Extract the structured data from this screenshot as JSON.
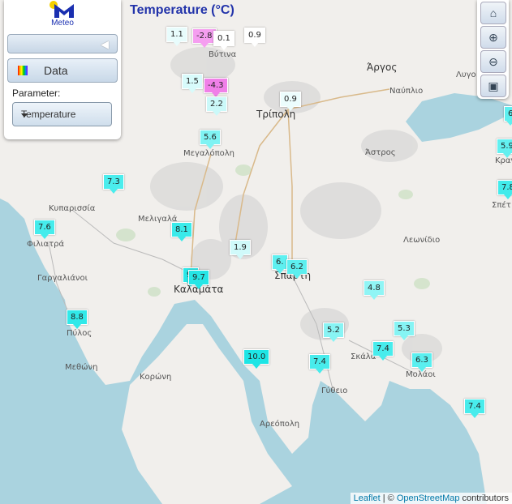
{
  "title": "Temperature (°C)",
  "panel": {
    "logo_text": "Meteo",
    "data_button": "Data",
    "parameter_label": "Parameter:",
    "parameter_value": "Temperature"
  },
  "attribution": {
    "leaflet": "Leaflet",
    "sep": " | © ",
    "osm": "OpenStreetMap",
    "rest": " contributors"
  },
  "places": [
    {
      "name": "Βύτινα"
    },
    {
      "name": "Τρίπολη",
      "big": true
    },
    {
      "name": "Άργος",
      "big": true
    },
    {
      "name": "Ναύπλιο"
    },
    {
      "name": "Λυγο"
    },
    {
      "name": "Άστρος"
    },
    {
      "name": "Μεγαλόπολη"
    },
    {
      "name": "Κυπαρισσία"
    },
    {
      "name": "Μελιγαλά"
    },
    {
      "name": "Φιλιατρά"
    },
    {
      "name": "Λεωνίδιο"
    },
    {
      "name": "Γαργαλιάνοι"
    },
    {
      "name": "Καλαμάτα",
      "big": true
    },
    {
      "name": "Σπάρτη",
      "big": true
    },
    {
      "name": "Πύλος"
    },
    {
      "name": "Μεθώνη"
    },
    {
      "name": "Κορώνη"
    },
    {
      "name": "Σκάλα"
    },
    {
      "name": "Μολάοι"
    },
    {
      "name": "Γύθειο"
    },
    {
      "name": "Αρεόπολη"
    },
    {
      "name": "Κραν"
    },
    {
      "name": "Σπέτ"
    }
  ],
  "markers": [
    {
      "value": "1.1",
      "color": "#e8fcfc"
    },
    {
      "value": "-2.8",
      "color": "#f59ef0"
    },
    {
      "value": "0.1",
      "color": "#ffffff"
    },
    {
      "value": "0.9",
      "color": "#ffffff"
    },
    {
      "value": "1.5",
      "color": "#d8fbfb"
    },
    {
      "value": "-4.3",
      "color": "#f080e8"
    },
    {
      "value": "2.2",
      "color": "#cbf9f9"
    },
    {
      "value": "0.9",
      "color": "#ecfdfd"
    },
    {
      "value": "5.6",
      "color": "#7ff3f3"
    },
    {
      "value": "7.3",
      "color": "#4beded"
    },
    {
      "value": "7.6",
      "color": "#45ecec"
    },
    {
      "value": "8.1",
      "color": "#3aeaea"
    },
    {
      "value": "1.9",
      "color": "#d0fafa"
    },
    {
      "value": "6.",
      "color": "#5ef0f0"
    },
    {
      "value": "6.2",
      "color": "#5cefef"
    },
    {
      "value": "9.",
      "color": "#2ae7e7"
    },
    {
      "value": "9.7",
      "color": "#25e6e6"
    },
    {
      "value": "4.8",
      "color": "#90f5f5"
    },
    {
      "value": "8.8",
      "color": "#31e9e9"
    },
    {
      "value": "5.2",
      "color": "#88f4f4"
    },
    {
      "value": "5.3",
      "color": "#86f4f4"
    },
    {
      "value": "7.4",
      "color": "#48ecec"
    },
    {
      "value": "10.0",
      "color": "#1ee5e5"
    },
    {
      "value": "7.4",
      "color": "#48ecec"
    },
    {
      "value": "6.3",
      "color": "#5aefef"
    },
    {
      "value": "7.4",
      "color": "#48ecec"
    },
    {
      "value": "6",
      "color": "#5ef0f0"
    },
    {
      "value": "5.9",
      "color": "#62f0f0"
    },
    {
      "value": "7.8",
      "color": "#42ebeb"
    }
  ]
}
